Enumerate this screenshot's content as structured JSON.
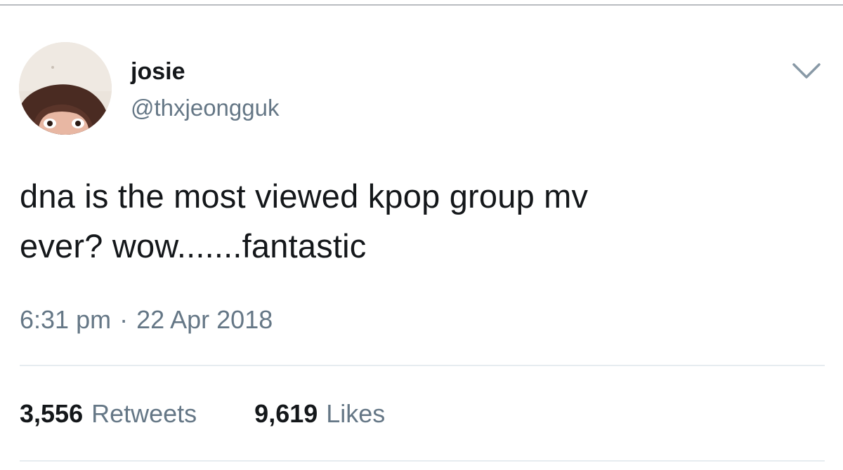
{
  "tweet": {
    "author": {
      "display_name": "josie",
      "handle": "@thxjeongguk",
      "avatar": "profile-photo"
    },
    "menu_icon": "chevron-down-icon",
    "text_lines": [
      "dna is the most viewed kpop group mv",
      "ever? wow.......fantastic"
    ],
    "time": "6:31 pm",
    "separator": "·",
    "date": "22 Apr 2018",
    "stats": {
      "retweets": {
        "count": "3,556",
        "label": "Retweets"
      },
      "likes": {
        "count": "9,619",
        "label": "Likes"
      }
    }
  },
  "colors": {
    "text_primary": "#14171a",
    "text_secondary": "#657786",
    "divider": "#e6ecf0",
    "background": "#ffffff"
  }
}
